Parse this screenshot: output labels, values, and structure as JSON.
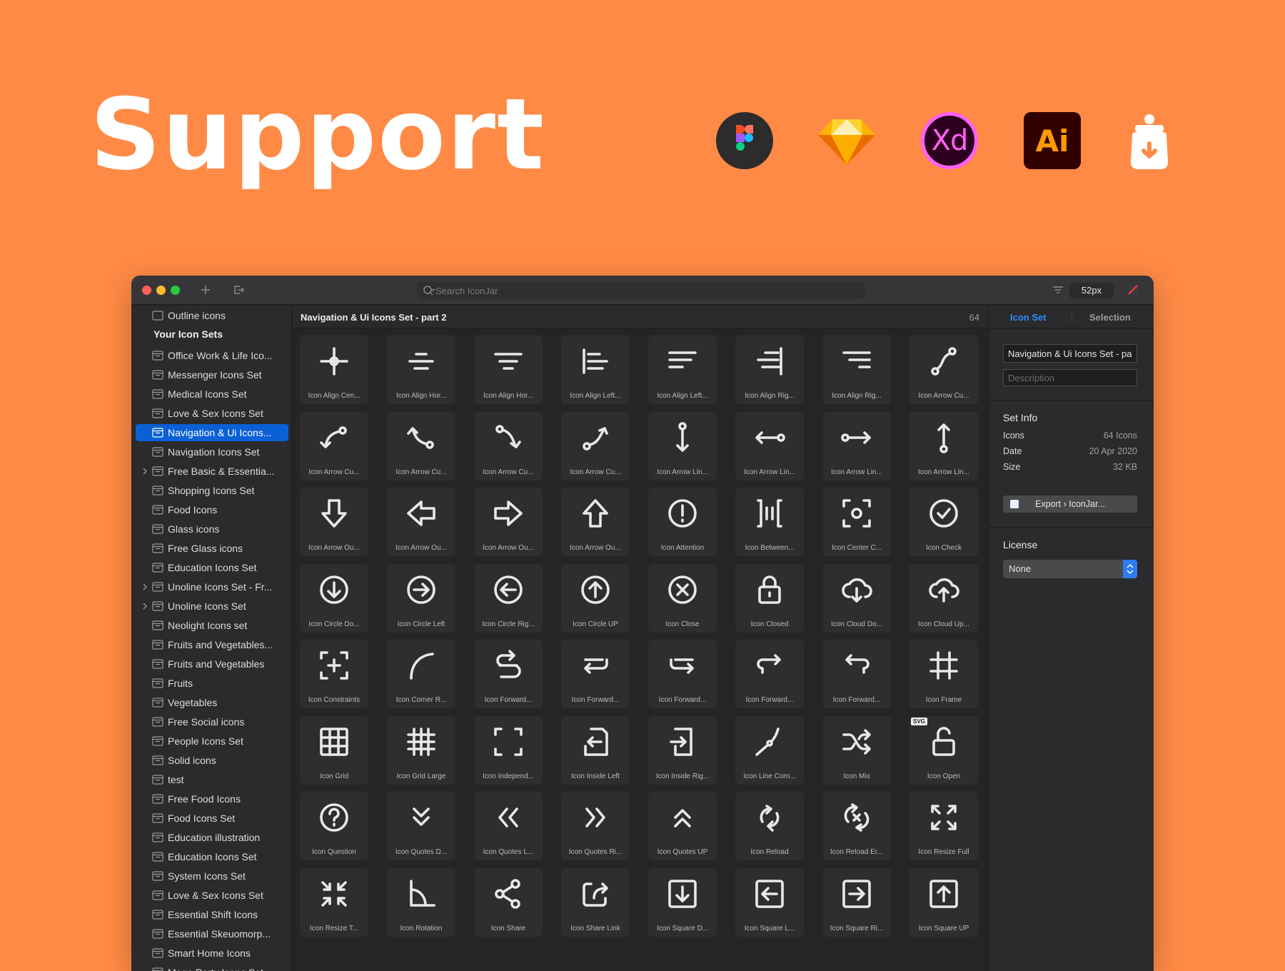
{
  "hero": {
    "title": "Support"
  },
  "window": {
    "search_placeholder": "Search IconJar",
    "size_label": "52px"
  },
  "sidebar": {
    "top_item": "Outline icons",
    "section_title": "Your Icon Sets",
    "items": [
      {
        "label": "Office Work & Life Ico...",
        "selected": false,
        "expandable": false
      },
      {
        "label": "Messenger Icons Set",
        "selected": false,
        "expandable": false
      },
      {
        "label": "Medical Icons Set",
        "selected": false,
        "expandable": false
      },
      {
        "label": "Love & Sex Icons Set",
        "selected": false,
        "expandable": false
      },
      {
        "label": "Navigation & Ui Icons...",
        "selected": true,
        "expandable": false
      },
      {
        "label": "Navigation Icons Set",
        "selected": false,
        "expandable": false
      },
      {
        "label": "Free Basic & Essentia...",
        "selected": false,
        "expandable": true
      },
      {
        "label": "Shopping Icons Set",
        "selected": false,
        "expandable": false
      },
      {
        "label": "Food Icons",
        "selected": false,
        "expandable": false
      },
      {
        "label": "Glass icons",
        "selected": false,
        "expandable": false
      },
      {
        "label": "Free Glass icons",
        "selected": false,
        "expandable": false
      },
      {
        "label": "Education Icons Set",
        "selected": false,
        "expandable": false
      },
      {
        "label": "Unoline Icons Set - Fr...",
        "selected": false,
        "expandable": true
      },
      {
        "label": "Unoline Icons Set",
        "selected": false,
        "expandable": true
      },
      {
        "label": "Neolight Icons set",
        "selected": false,
        "expandable": false
      },
      {
        "label": "Fruits and Vegetables...",
        "selected": false,
        "expandable": false
      },
      {
        "label": "Fruits and Vegetables",
        "selected": false,
        "expandable": false
      },
      {
        "label": "Fruits",
        "selected": false,
        "expandable": false
      },
      {
        "label": "Vegetables",
        "selected": false,
        "expandable": false
      },
      {
        "label": "Free Social icons",
        "selected": false,
        "expandable": false
      },
      {
        "label": "People Icons Set",
        "selected": false,
        "expandable": false
      },
      {
        "label": "Solid icons",
        "selected": false,
        "expandable": false
      },
      {
        "label": "test",
        "selected": false,
        "expandable": false
      },
      {
        "label": "Free Food Icons",
        "selected": false,
        "expandable": false
      },
      {
        "label": "Food Icons Set",
        "selected": false,
        "expandable": false
      },
      {
        "label": "Education illustration",
        "selected": false,
        "expandable": false
      },
      {
        "label": "Education Icons Set",
        "selected": false,
        "expandable": false
      },
      {
        "label": "System Icons Set",
        "selected": false,
        "expandable": false
      },
      {
        "label": "Love & Sex Icons Set",
        "selected": false,
        "expandable": false
      },
      {
        "label": "Essential Shift Icons",
        "selected": false,
        "expandable": false
      },
      {
        "label": "Essential Skeuomorp...",
        "selected": false,
        "expandable": false
      },
      {
        "label": "Smart Home Icons",
        "selected": false,
        "expandable": false
      },
      {
        "label": "Mega Party Icons Set",
        "selected": false,
        "expandable": false
      }
    ]
  },
  "main": {
    "title": "Navigation & Ui Icons Set - part 2",
    "count": "64",
    "icons": [
      {
        "label": "Icon Align Cen...",
        "glyph": "align-center"
      },
      {
        "label": "Icon Align Hor...",
        "glyph": "align-hor-1"
      },
      {
        "label": "Icon Align Hor...",
        "glyph": "align-hor-2"
      },
      {
        "label": "Icon Align Left...",
        "glyph": "align-left-1"
      },
      {
        "label": "Icon Align Left...",
        "glyph": "align-left-2"
      },
      {
        "label": "Icon Align Rig...",
        "glyph": "align-right-1"
      },
      {
        "label": "Icon Align Rig...",
        "glyph": "align-right-2"
      },
      {
        "label": "Icon Arrow Cu...",
        "glyph": "curve-1"
      },
      {
        "label": "Icon Arrow Cu...",
        "glyph": "curve-2"
      },
      {
        "label": "Icon Arrow Cu...",
        "glyph": "curve-3"
      },
      {
        "label": "Icon Arrow Cu...",
        "glyph": "curve-4"
      },
      {
        "label": "Icon Arrow Cu...",
        "glyph": "curve-5"
      },
      {
        "label": "Icon Arrow Lin...",
        "glyph": "line-v"
      },
      {
        "label": "Icon Arrow Lin...",
        "glyph": "line-h-left"
      },
      {
        "label": "Icon Arrow Lin...",
        "glyph": "line-h-right"
      },
      {
        "label": "Icon Arrow Lin...",
        "glyph": "line-v-up"
      },
      {
        "label": "Icon Arrow Ou...",
        "glyph": "outline-down"
      },
      {
        "label": "Icon Arrow Ou...",
        "glyph": "outline-left"
      },
      {
        "label": "Icon Arrow Ou...",
        "glyph": "outline-right"
      },
      {
        "label": "Icon Arrow Ou...",
        "glyph": "outline-up"
      },
      {
        "label": "Icon Attention",
        "glyph": "attention"
      },
      {
        "label": "Icon Between...",
        "glyph": "between"
      },
      {
        "label": "Icon Center C...",
        "glyph": "center"
      },
      {
        "label": "Icon Check",
        "glyph": "check"
      },
      {
        "label": "Icon Circle Do...",
        "glyph": "circle-down"
      },
      {
        "label": "Icon Circle Left",
        "glyph": "circle-right-arrow"
      },
      {
        "label": "Icon Circle Rig...",
        "glyph": "circle-left-arrow"
      },
      {
        "label": "Icon Circle UP",
        "glyph": "circle-up"
      },
      {
        "label": "Icon Close",
        "glyph": "close"
      },
      {
        "label": "Icon Closed",
        "glyph": "lock"
      },
      {
        "label": "Icon Cloud Do...",
        "glyph": "cloud-down"
      },
      {
        "label": "Icon Cloud Up...",
        "glyph": "cloud-up"
      },
      {
        "label": "Icon Constraints",
        "glyph": "constraints"
      },
      {
        "label": "Icon Corner R...",
        "glyph": "corner"
      },
      {
        "label": "Icon Forward...",
        "glyph": "fwd-1"
      },
      {
        "label": "Icon Forward...",
        "glyph": "fwd-2"
      },
      {
        "label": "Icon Forward...",
        "glyph": "fwd-3"
      },
      {
        "label": "Icon Forward...",
        "glyph": "fwd-4"
      },
      {
        "label": "Icon Forward...",
        "glyph": "fwd-5"
      },
      {
        "label": "Icon Frame",
        "glyph": "frame"
      },
      {
        "label": "Icon Grid",
        "glyph": "grid"
      },
      {
        "label": "Icon Grid Large",
        "glyph": "grid-large"
      },
      {
        "label": "Icon Independ...",
        "glyph": "independent"
      },
      {
        "label": "Icon Inside Left",
        "glyph": "inside-left"
      },
      {
        "label": "Icon Inside Rig...",
        "glyph": "inside-right"
      },
      {
        "label": "Icon Line Corn...",
        "glyph": "line-corner"
      },
      {
        "label": "Icon Mix",
        "glyph": "mix"
      },
      {
        "label": "Icon Open",
        "glyph": "open",
        "badge": "SVG"
      },
      {
        "label": "Icon Question",
        "glyph": "question"
      },
      {
        "label": "Icon Quotes D...",
        "glyph": "quotes-down"
      },
      {
        "label": "Icon Quotes L...",
        "glyph": "quotes-left"
      },
      {
        "label": "Icon Quotes Ri...",
        "glyph": "quotes-right"
      },
      {
        "label": "Icon Quotes UP",
        "glyph": "quotes-up"
      },
      {
        "label": "Icon Reload",
        "glyph": "reload"
      },
      {
        "label": "Icon Reload Er...",
        "glyph": "reload-error"
      },
      {
        "label": "Icon Resize Full",
        "glyph": "resize-full"
      },
      {
        "label": "Icon Resize T...",
        "glyph": "resize-small"
      },
      {
        "label": "Icon Rotation",
        "glyph": "rotation"
      },
      {
        "label": "Icon Share",
        "glyph": "share"
      },
      {
        "label": "Icon Share Link",
        "glyph": "share-link"
      },
      {
        "label": "Icon Square D...",
        "glyph": "square-down"
      },
      {
        "label": "Icon Square L...",
        "glyph": "square-left"
      },
      {
        "label": "Icon Square Ri...",
        "glyph": "square-right"
      },
      {
        "label": "Icon Square UP",
        "glyph": "square-up"
      }
    ]
  },
  "inspector": {
    "tabs": [
      "Icon Set",
      "Selection"
    ],
    "name_value": "Navigation & Ui Icons Set - pa",
    "description_placeholder": "Description",
    "set_info_title": "Set Info",
    "info": [
      {
        "key": "Icons",
        "value": "64 Icons"
      },
      {
        "key": "Date",
        "value": "20 Apr 2020"
      },
      {
        "key": "Size",
        "value": "32 KB"
      }
    ],
    "export_label": "Export › IconJar...",
    "license_title": "License",
    "license_value": "None"
  },
  "colors": {
    "background": "#FF8A45",
    "accent": "#0a60d4",
    "tab_active": "#2f8cff"
  }
}
